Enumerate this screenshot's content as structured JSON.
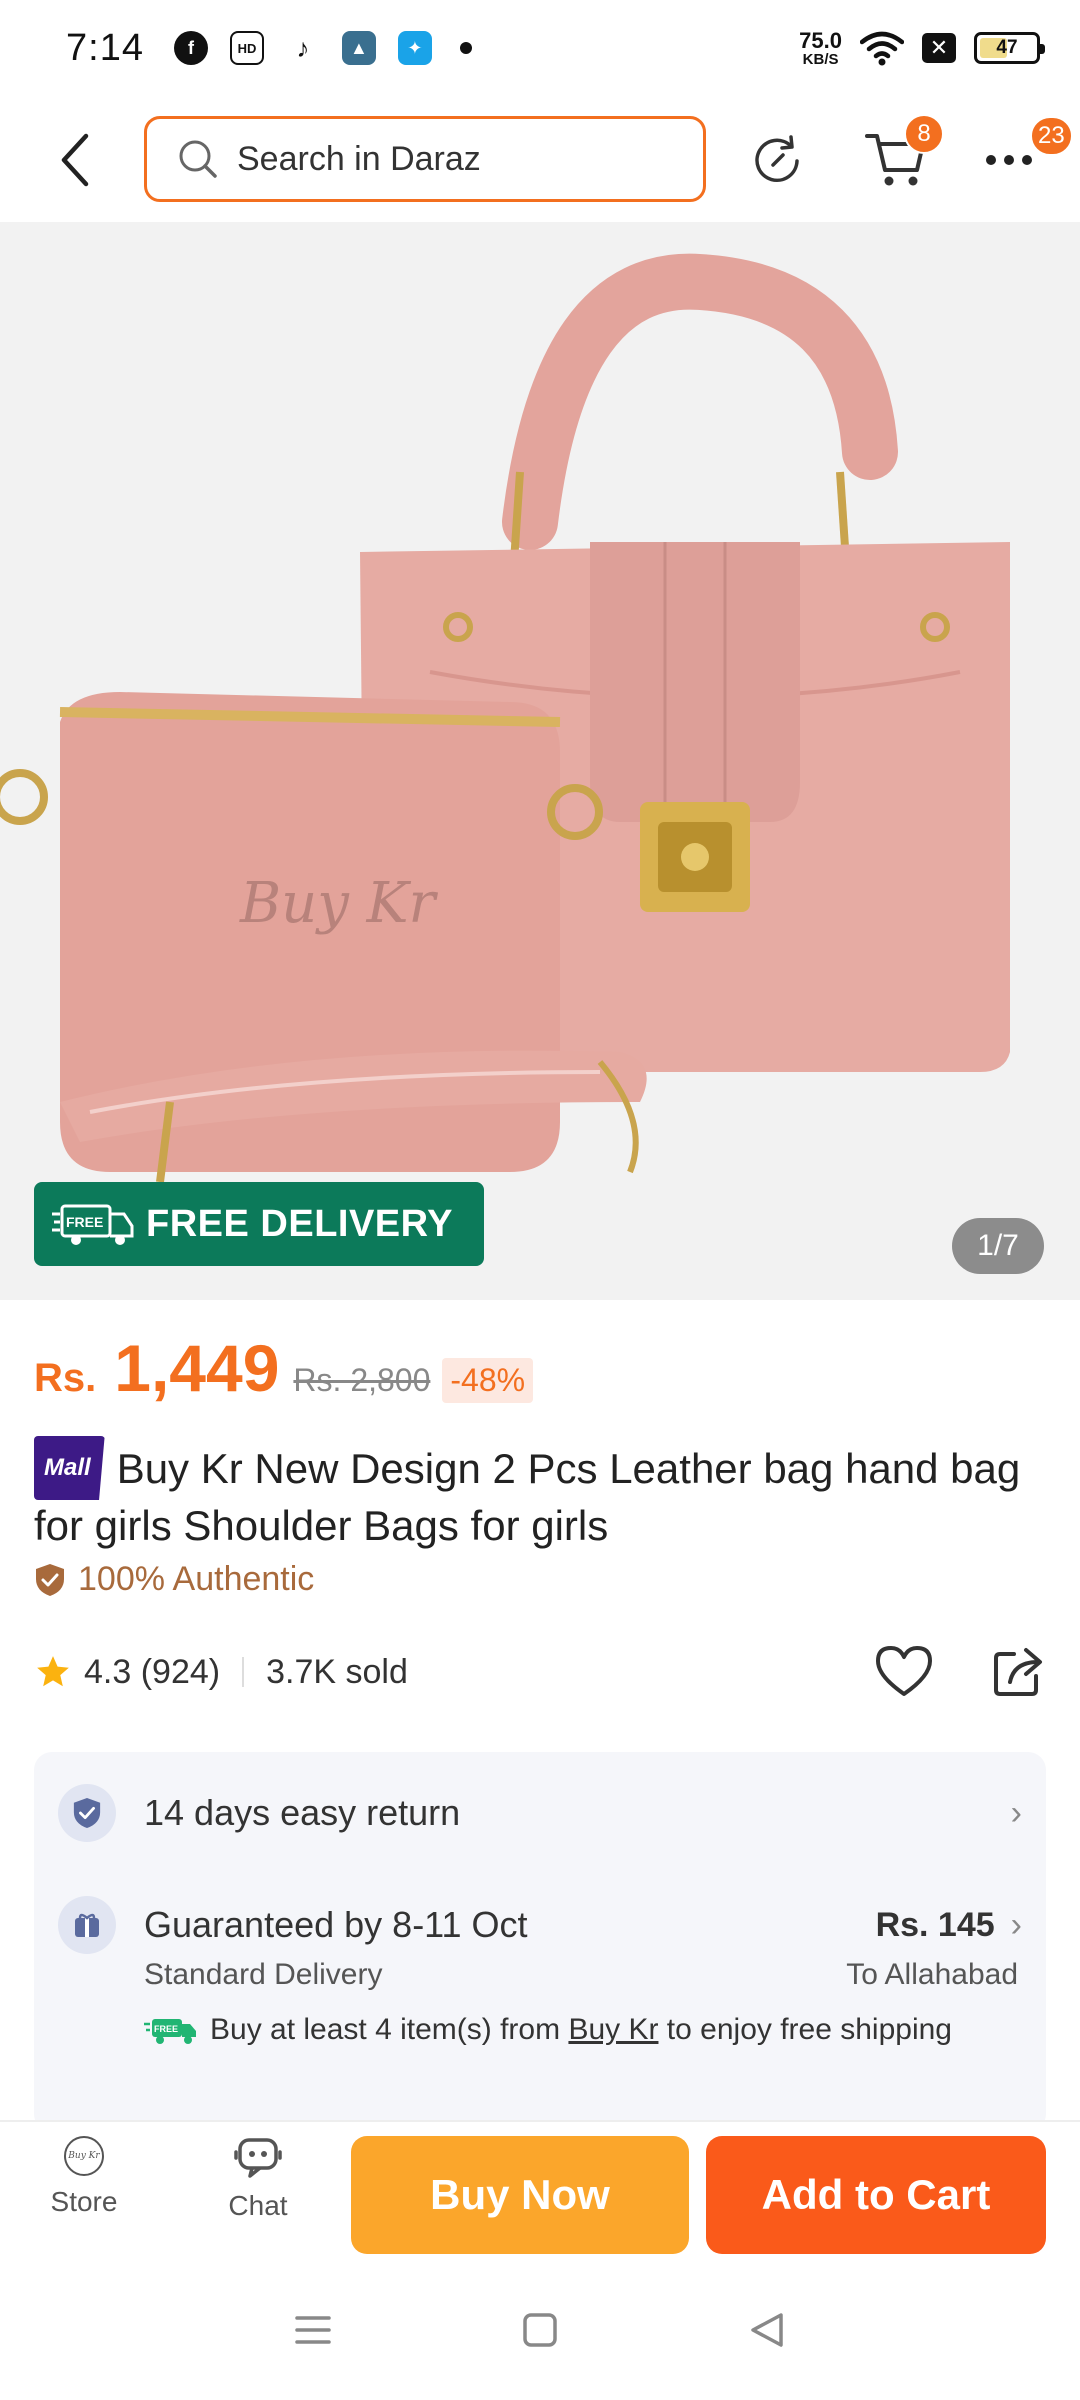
{
  "status_bar": {
    "time": "7:14",
    "speed_value": "75.0",
    "speed_unit": "KB/S",
    "battery": "47",
    "app_icons": [
      "facebook-icon",
      "hd-app-icon",
      "tiktok-icon",
      "game-app-icon",
      "telenor-icon"
    ]
  },
  "header": {
    "search_placeholder": "Search in Daraz",
    "cart_badge": "8",
    "more_badge": "23"
  },
  "gallery": {
    "free_delivery_label": "FREE DELIVERY",
    "free_tag": "FREE",
    "counter": "1/7",
    "bag_brand_text": "Buy Kr"
  },
  "price": {
    "currency": "Rs.",
    "current": "1,449",
    "original": "Rs. 2,800",
    "discount": "-48%"
  },
  "product": {
    "mall_badge": "Mall",
    "title": "Buy Kr New Design 2 Pcs Leather bag hand bag for girls Shoulder Bags for girls",
    "authentic": "100% Authentic",
    "rating": "4.3 (924)",
    "sold": "3.7K sold"
  },
  "service": {
    "return_label": "14 days easy return",
    "delivery_label": "Guaranteed by 8-11 Oct",
    "delivery_price": "Rs. 145",
    "delivery_type": "Standard Delivery",
    "delivery_location": "To Allahabad",
    "promo_prefix": "Buy at least 4 item(s) from ",
    "promo_store": "Buy Kr",
    "promo_suffix": " to enjoy free shipping"
  },
  "actions": {
    "store_label": "Store",
    "chat_label": "Chat",
    "buy_now": "Buy Now",
    "add_to_cart": "Add to Cart",
    "store_logo_text": "Buy Kr"
  },
  "colors": {
    "accent": "#f36f1f",
    "buy_now": "#fba62b",
    "add_to_cart": "#fa5a1a",
    "free_delivery": "#0c7a5a",
    "mall": "#3d1a86"
  }
}
